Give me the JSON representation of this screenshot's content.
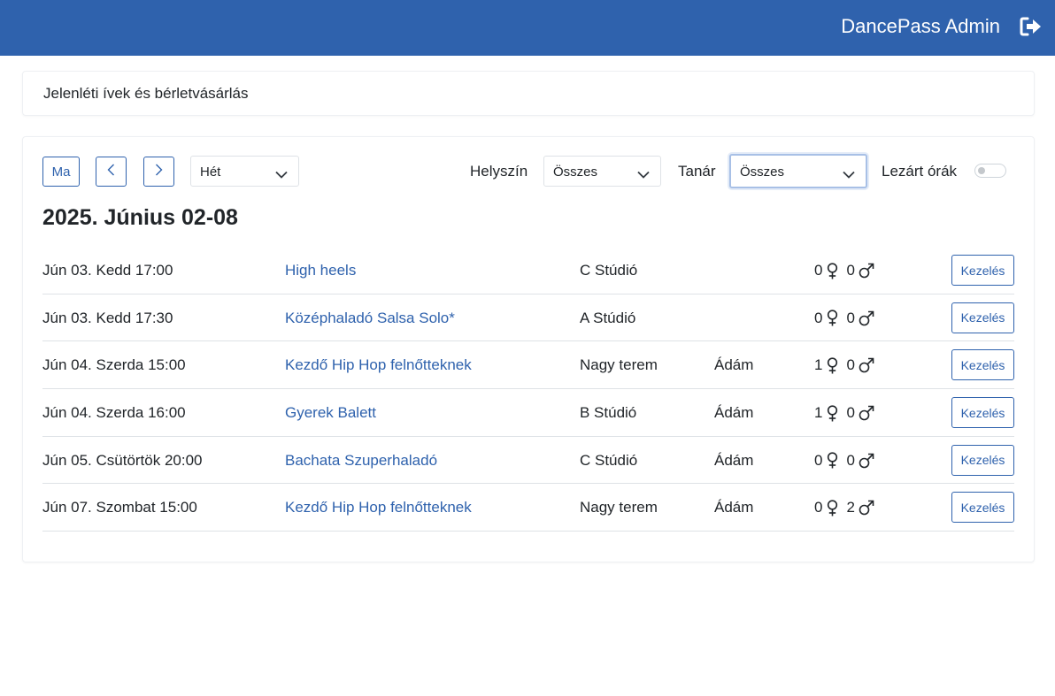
{
  "header": {
    "brand": "DancePass Admin",
    "logout_icon": "sign-out-icon",
    "background": "#2f62ad"
  },
  "title_card": {
    "text": "Jelenléti ívek és bérletvásárlás"
  },
  "toolbar": {
    "today_label": "Ma",
    "prev_icon": "chevron-left-icon",
    "next_icon": "chevron-right-icon",
    "period_value": "Hét",
    "location_label": "Helyszín",
    "location_value": "Összes",
    "teacher_label": "Tanár",
    "teacher_value": "Összes",
    "closed_label": "Lezárt órák",
    "closed_toggle_on": false
  },
  "week_heading": "2025. Június 02-08",
  "sessions": [
    {
      "time": "Jún 03. Kedd 17:00",
      "class": "High heels",
      "room": "C Stúdió",
      "teacher": "",
      "female": "0",
      "male": "0",
      "action": "Kezelés"
    },
    {
      "time": "Jún 03. Kedd 17:30",
      "class": "Középhaladó Salsa Solo*",
      "room": "A Stúdió",
      "teacher": "",
      "female": "0",
      "male": "0",
      "action": "Kezelés"
    },
    {
      "time": "Jún 04. Szerda 15:00",
      "class": "Kezdő Hip Hop felnőtteknek",
      "room": "Nagy terem",
      "teacher": "Ádám",
      "female": "1",
      "male": "0",
      "action": "Kezelés"
    },
    {
      "time": "Jún 04. Szerda 16:00",
      "class": "Gyerek Balett",
      "room": "B Stúdió",
      "teacher": "Ádám",
      "female": "1",
      "male": "0",
      "action": "Kezelés"
    },
    {
      "time": "Jún 05. Csütörtök 20:00",
      "class": "Bachata Szuperhaladó",
      "room": "C Stúdió",
      "teacher": "Ádám",
      "female": "0",
      "male": "0",
      "action": "Kezelés"
    },
    {
      "time": "Jún 07. Szombat 15:00",
      "class": "Kezdő Hip Hop felnőtteknek",
      "room": "Nagy terem",
      "teacher": "Ádám",
      "female": "0",
      "male": "2",
      "action": "Kezelés"
    }
  ]
}
